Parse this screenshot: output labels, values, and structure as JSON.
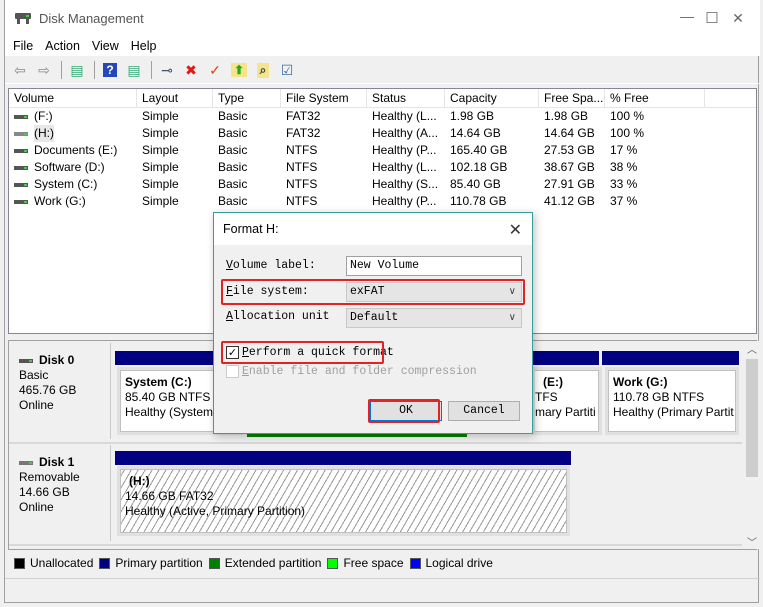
{
  "window": {
    "title": "Disk Management",
    "minimize": "—",
    "maximize": "☐",
    "close": "✕"
  },
  "menu": [
    "File",
    "Action",
    "View",
    "Help"
  ],
  "toolbar": [
    {
      "icon": "back-arrow-icon",
      "glyph": "⇦",
      "color": "#888"
    },
    {
      "icon": "forward-arrow-icon",
      "glyph": "⇨",
      "color": "#888"
    },
    {
      "sep": true
    },
    {
      "icon": "show-hide-console-tree-icon",
      "glyph": "▤",
      "color": "#3a7"
    },
    {
      "sep": true
    },
    {
      "icon": "help-icon",
      "glyph": "?",
      "color": "#fff",
      "bg": "#2448b8"
    },
    {
      "icon": "show-action-pane-icon",
      "glyph": "▤",
      "color": "#3a7"
    },
    {
      "sep": true
    },
    {
      "icon": "connect-drive-icon",
      "glyph": "⊸",
      "color": "#456"
    },
    {
      "icon": "delete-icon",
      "glyph": "✖",
      "color": "#e01818"
    },
    {
      "icon": "properties-icon",
      "glyph": "✓",
      "color": "#e04020"
    },
    {
      "icon": "open-folder-icon",
      "glyph": "⬆",
      "color": "#2a2",
      "bg": "#f6e48a"
    },
    {
      "icon": "explore-icon",
      "glyph": "⌕",
      "color": "#345",
      "bg": "#f6e48a"
    },
    {
      "icon": "checklist-icon",
      "glyph": "☑",
      "color": "#3a6ea5"
    }
  ],
  "volume_list": {
    "columns": [
      "Volume",
      "Layout",
      "Type",
      "File System",
      "Status",
      "Capacity",
      "Free Spa...",
      "% Free"
    ],
    "rows": [
      [
        " (F:)",
        "Simple",
        "Basic",
        "FAT32",
        "Healthy (L...",
        "1.98 GB",
        "1.98 GB",
        "100 %"
      ],
      [
        " (H:)",
        "Simple",
        "Basic",
        "FAT32",
        "Healthy (A...",
        "14.64 GB",
        "14.64 GB",
        "100 %"
      ],
      [
        "Documents (E:)",
        "Simple",
        "Basic",
        "NTFS",
        "Healthy (P...",
        "165.40 GB",
        "27.53 GB",
        "17 %"
      ],
      [
        "Software (D:)",
        "Simple",
        "Basic",
        "NTFS",
        "Healthy (L...",
        "102.18 GB",
        "38.67 GB",
        "38 %"
      ],
      [
        "System (C:)",
        "Simple",
        "Basic",
        "NTFS",
        "Healthy (S...",
        "85.40 GB",
        "27.91 GB",
        "33 %"
      ],
      [
        "Work (G:)",
        "Simple",
        "Basic",
        "NTFS",
        "Healthy (P...",
        "110.78 GB",
        "41.12 GB",
        "37 %"
      ]
    ]
  },
  "disks": [
    {
      "name": "Disk 0",
      "type": "Basic",
      "size": "465.76 GB",
      "state": "Online",
      "partitions": [
        {
          "name": "System  (C:)",
          "size": "85.40 GB NTFS",
          "status": "Healthy (System, B"
        },
        {
          "name": "(E:)",
          "size": "TFS",
          "status": "mary Partiti"
        },
        {
          "name": "Work  (G:)",
          "size": "110.78 GB NTFS",
          "status": "Healthy (Primary Partit"
        }
      ]
    },
    {
      "name": "Disk 1",
      "type": "Removable",
      "size": "14.66 GB",
      "state": "Online",
      "partitions": [
        {
          "name": "(H:)",
          "size": "14.66 GB FAT32",
          "status": "Healthy (Active, Primary Partition)"
        }
      ]
    }
  ],
  "legend": [
    {
      "label": "Unallocated",
      "color": "#000000"
    },
    {
      "label": "Primary partition",
      "color": "#000080"
    },
    {
      "label": "Extended partition",
      "color": "#008000"
    },
    {
      "label": "Free space",
      "color": "#00ff00"
    },
    {
      "label": "Logical drive",
      "color": "#0000ff"
    }
  ],
  "dialog": {
    "title": "Format H:",
    "volume_label": {
      "label_u": "V",
      "label_rest": "olume label:",
      "value": "New Volume"
    },
    "file_system": {
      "label_u": "F",
      "label_rest": "ile system:",
      "value": "exFAT"
    },
    "allocation_unit": {
      "label_u": "A",
      "label_rest": "llocation unit",
      "value": "Default"
    },
    "quick_format": {
      "label_u": "P",
      "label_rest": "erform a quick format",
      "checked": true
    },
    "compression": {
      "label_u": "E",
      "label_rest": "nable file and folder compression",
      "checked": false,
      "enabled": false
    },
    "ok": "OK",
    "cancel": "Cancel",
    "highlight_color": "#e52222"
  }
}
